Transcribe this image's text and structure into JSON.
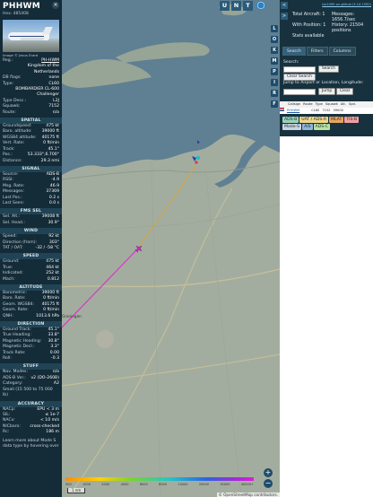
{
  "aircraft": {
    "callsign": "PHHWM",
    "hex_line": "Hex: 485408",
    "image_credit": "Image © Jesus Erard"
  },
  "info": [
    {
      "k": "Reg.:",
      "v": "PH-HWM",
      "link": true
    },
    {
      "k": "",
      "v": "Kingdom of the Netherlands"
    },
    {
      "k": "DB flags:",
      "v": "none"
    },
    {
      "k": "Type:",
      "v": "CL60"
    },
    {
      "k": "",
      "v": "BOMBARDIER CL-600 Challenger"
    },
    {
      "k": "Type Desc.:",
      "v": "L2J"
    },
    {
      "k": "Squawk:",
      "v": "7152"
    },
    {
      "k": "Route:",
      "v": "n/a"
    }
  ],
  "sections": [
    {
      "title": "SPATIAL",
      "rows": [
        {
          "k": "Groundspeed:",
          "v": "475 kt"
        },
        {
          "k": "Baro. altitude:",
          "v": "39000 ft"
        },
        {
          "k": "WGS84 altitude:",
          "v": "40175 ft"
        },
        {
          "k": "Vert. Rate:",
          "v": "0 ft/min"
        },
        {
          "k": "Track:",
          "v": "45.1°"
        },
        {
          "k": "Pos.:",
          "v": "53.333°,6.700°"
        },
        {
          "k": "Distance:",
          "v": "29.3 nmi"
        }
      ]
    },
    {
      "title": "SIGNAL",
      "rows": [
        {
          "k": "Source:",
          "v": "ADS-B"
        },
        {
          "k": "RSSI:",
          "v": "-4.9"
        },
        {
          "k": "Msg. Rate:",
          "v": "46.9"
        },
        {
          "k": "Messages:",
          "v": "37369"
        },
        {
          "k": "Last Pos.:",
          "v": "0.2 s"
        },
        {
          "k": "Last Seen:",
          "v": "0.0 s"
        }
      ]
    },
    {
      "title": "FMS SEL",
      "rows": [
        {
          "k": "Sel. Alt.:",
          "v": "39008 ft"
        },
        {
          "k": "Sel. Head.:",
          "v": "30.9°"
        }
      ]
    },
    {
      "title": "WIND",
      "rows": [
        {
          "k": "Speed:",
          "v": "92 kt"
        },
        {
          "k": "Direction (from):",
          "v": "303°"
        },
        {
          "k": "TAT / OAT:",
          "v": "-32 / -58 °C"
        }
      ]
    },
    {
      "title": "SPEED",
      "rows": [
        {
          "k": "Ground:",
          "v": "475 kt"
        },
        {
          "k": "True:",
          "v": "464 kt"
        },
        {
          "k": "Indicated:",
          "v": "252 kt"
        },
        {
          "k": "Mach:",
          "v": "0.812"
        }
      ]
    },
    {
      "title": "ALTITUDE",
      "rows": [
        {
          "k": "Barometric:",
          "v": "39000 ft"
        },
        {
          "k": "Baro. Rate:",
          "v": "0 ft/min"
        },
        {
          "k": "Geom. WGS84:",
          "v": "40175 ft"
        },
        {
          "k": "Geom. Rate:",
          "v": "0 ft/min"
        },
        {
          "k": "QNH:",
          "v": "1013.6 hPa"
        }
      ]
    },
    {
      "title": "DIRECTION",
      "rows": [
        {
          "k": "Ground Track:",
          "v": "45.1°"
        },
        {
          "k": "True Heading:",
          "v": "33.8°"
        },
        {
          "k": "Magnetic Heading:",
          "v": "30.8°"
        },
        {
          "k": "Magnetic Decl.:",
          "v": "3.3°"
        },
        {
          "k": "Track Rate:",
          "v": "0.00"
        },
        {
          "k": "Roll:",
          "v": "-0.3"
        }
      ]
    },
    {
      "title": "STUFF",
      "rows": [
        {
          "k": "Nav. Modes:",
          "v": "n/a"
        },
        {
          "k": "ADS-B Ver.:",
          "v": "v2 (DO-260B)"
        },
        {
          "k": "Category:",
          "v": "A2"
        },
        {
          "k": "Small (15 500 to 75 000 lb)",
          "v": ""
        }
      ]
    },
    {
      "title": "ACCURACY",
      "rows": [
        {
          "k": "NACp:",
          "v": "EPU < 3 m"
        },
        {
          "k": "SIL:",
          "v": "≤ 1e-7"
        },
        {
          "k": "NACv:",
          "v": "< 10 m/s"
        },
        {
          "k": "NICbaro:",
          "v": "cross-checked"
        },
        {
          "k": "Rc:",
          "v": "186 m"
        }
      ]
    }
  ],
  "footer_text": "Learn more about Mode S data type by hovering over",
  "map": {
    "top_buttons": [
      "U",
      "N",
      "T"
    ],
    "left_arrow": "<",
    "right_arrow": ">",
    "layer_buttons": [
      "L",
      "O",
      "K",
      "M",
      "P",
      "I",
      "R",
      "F"
    ],
    "scale_label": "1 nm",
    "attribution": "© OpenStreetMap contributors.",
    "zoom_in": "+",
    "zoom_out": "−",
    "city_label": "Groningen",
    "altitude_scale": [
      "500",
      "1000",
      "2000",
      "4000",
      "6000",
      "8000",
      "10000",
      "20000",
      "30000",
      "40000+"
    ]
  },
  "right": {
    "link_text": "tar1090 on github (3.14.1592)",
    "total_aircraft_label": "Total Aircraft: 1",
    "messages_label": "Messages:",
    "messages_value": "1656.7/sec",
    "with_position_label": "With Position: 1",
    "history_label": "History: 21504 positions",
    "stats_label": "Stats available",
    "tabs": [
      "Search",
      "Filters",
      "Columns"
    ],
    "search_label": "Search:",
    "search_button": "Search",
    "clear_search_button": "Clear Search",
    "jump_label": "Jump to Airport or Location, Longitude:",
    "jump_button": "Jump",
    "clear_button": "Clear",
    "table_headers": [
      "Callsign",
      "Route",
      "Type",
      "Squawk",
      "Alt.",
      "Spd."
    ],
    "table_row": [
      "PHHWM",
      "",
      "CL60",
      "7152",
      "39000",
      ""
    ],
    "chips": [
      {
        "label": "ADS-B",
        "color": "#9bd3b8"
      },
      {
        "label": "UAT / ADS-R",
        "color": "#f0d58a"
      },
      {
        "label": "MLAT",
        "color": "#e8a35c"
      },
      {
        "label": "TIS-B",
        "color": "#f4a0a0"
      },
      {
        "label": "Mode-S",
        "color": "#c9d6e2"
      },
      {
        "label": "AIS",
        "color": "#8fb6d9"
      },
      {
        "label": "ADS-C",
        "color": "#b9e3a1"
      }
    ]
  }
}
